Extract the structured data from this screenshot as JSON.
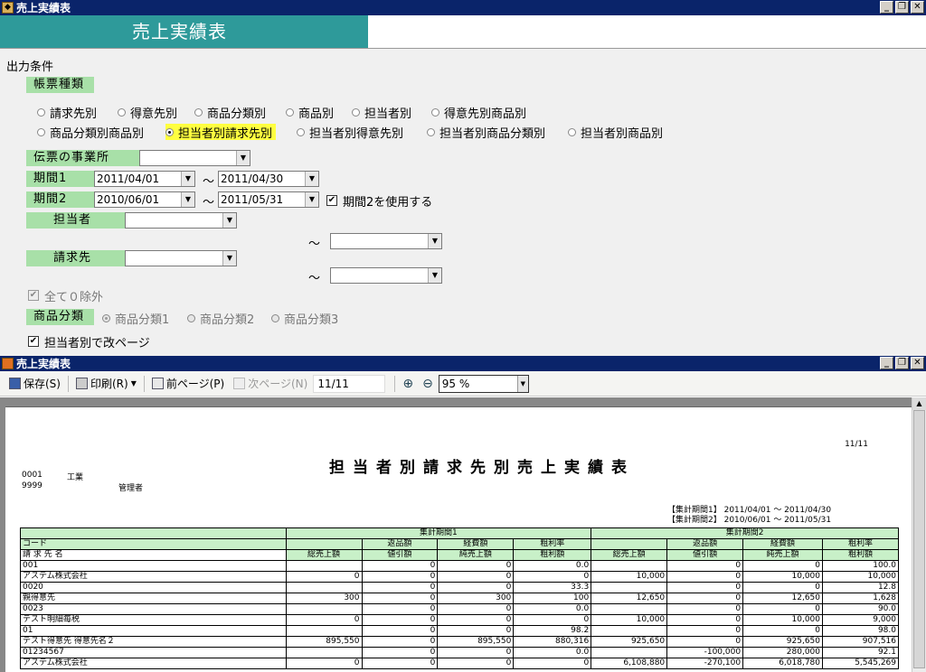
{
  "window": {
    "title": "売上実績表"
  },
  "header": {
    "banner": "売上実績表"
  },
  "conditions": {
    "section_label": "出力条件",
    "report_type_label": "帳票種類",
    "report_types_row1": [
      "請求先別",
      "得意先別",
      "商品分類別",
      "商品別",
      "担当者別",
      "得意先別商品別"
    ],
    "report_types_row2": [
      "商品分類別商品別",
      "担当者別請求先別",
      "担当者別得意先別",
      "担当者別商品分類別",
      "担当者別商品別"
    ],
    "selected_type": "担当者別請求先別",
    "office_label": "伝票の事業所",
    "office_value": "",
    "period1_label": "期間1",
    "period1_from": "2011/04/01",
    "period1_to": "2011/04/30",
    "period2_label": "期間2",
    "period2_from": "2010/06/01",
    "period2_to": "2011/05/31",
    "use_period2_label": "期間2を使用する",
    "use_period2_checked": true,
    "tilde": "～",
    "staff_label": "担当者",
    "customer_label": "請求先",
    "exclude_zero_label": "全て０除外",
    "category_label": "商品分類",
    "category_options": [
      "商品分類1",
      "商品分類2",
      "商品分類3"
    ],
    "category_selected": "商品分類1",
    "page_break_label": "担当者別で改ページ"
  },
  "viewer": {
    "title": "売上実績表",
    "save": "保存(S)",
    "print": "印刷(R)",
    "prev_page": "前ページ(P)",
    "next_page": "次ページ(N)",
    "page_indicator": "11/11",
    "zoom": "95 %"
  },
  "report": {
    "page_no": "11/11",
    "title": "担当者別請求先別売上実績表",
    "staff_code": "0001",
    "staff_name": "工業",
    "admin_code": "9999",
    "admin_name": "管理者",
    "period1_line": "【集計期間1】 2011/04/01 ～ 2011/04/30",
    "period2_line": "【集計期間2】 2010/06/01 ～ 2011/05/31",
    "headers": {
      "group1": "集計期間1",
      "group2": "集計期間2",
      "code": "コード",
      "name": "請 求 先 名",
      "returns": "返品額",
      "discount": "値引額",
      "expense": "経費額",
      "net_sales": "純売上額",
      "margin_rate": "粗利率",
      "gross_profit": "粗利額",
      "total_sales": "総売上額"
    },
    "rows": [
      {
        "code": "001",
        "name": "アステム株式会社",
        "p1": [
          "",
          "0",
          "0",
          "0",
          "0.0",
          "0"
        ],
        "p2": [
          "",
          "10,000",
          "0",
          "0",
          "0",
          "100.0",
          "10,000"
        ],
        "p1b": [
          "0",
          "0",
          "0",
          "0"
        ],
        "p1top": [
          "0",
          "0",
          "0.0"
        ],
        "p1bot": [
          "0",
          "0",
          "0",
          "0"
        ],
        "p2top": [
          "0",
          "0",
          "100.0"
        ],
        "p2bot": [
          "10,000",
          "0",
          "10,000",
          "10,000"
        ]
      },
      {
        "code": "0020",
        "name": "親得意先",
        "p1top": [
          "0",
          "0",
          "33.3"
        ],
        "p1bot": [
          "300",
          "0",
          "300",
          "100"
        ],
        "p2top": [
          "0",
          "0",
          "12.8"
        ],
        "p2bot": [
          "12,650",
          "0",
          "12,650",
          "1,628"
        ]
      },
      {
        "code": "0023",
        "name": "テスト明細毎税",
        "p1top": [
          "0",
          "0",
          "0.0"
        ],
        "p1bot": [
          "0",
          "0",
          "0",
          "0"
        ],
        "p2top": [
          "0",
          "0",
          "90.0"
        ],
        "p2bot": [
          "10,000",
          "0",
          "10,000",
          "9,000"
        ]
      },
      {
        "code": "01",
        "name": "テスト得意先 得意先名２",
        "p1top": [
          "0",
          "0",
          "98.2"
        ],
        "p1bot": [
          "895,550",
          "0",
          "895,550",
          "880,316"
        ],
        "p2top": [
          "0",
          "0",
          "98.0"
        ],
        "p2bot": [
          "925,650",
          "0",
          "925,650",
          "907,516"
        ]
      },
      {
        "code": "01234567",
        "name": "アステム株式会社",
        "p1top": [
          "0",
          "0",
          "0.0"
        ],
        "p1bot": [
          "0",
          "0",
          "0",
          "0"
        ],
        "p2top": [
          "-100,000",
          "280,000",
          "92.1"
        ],
        "p2bot": [
          "6,108,880",
          "-270,100",
          "6,018,780",
          "5,545,269"
        ]
      }
    ]
  }
}
